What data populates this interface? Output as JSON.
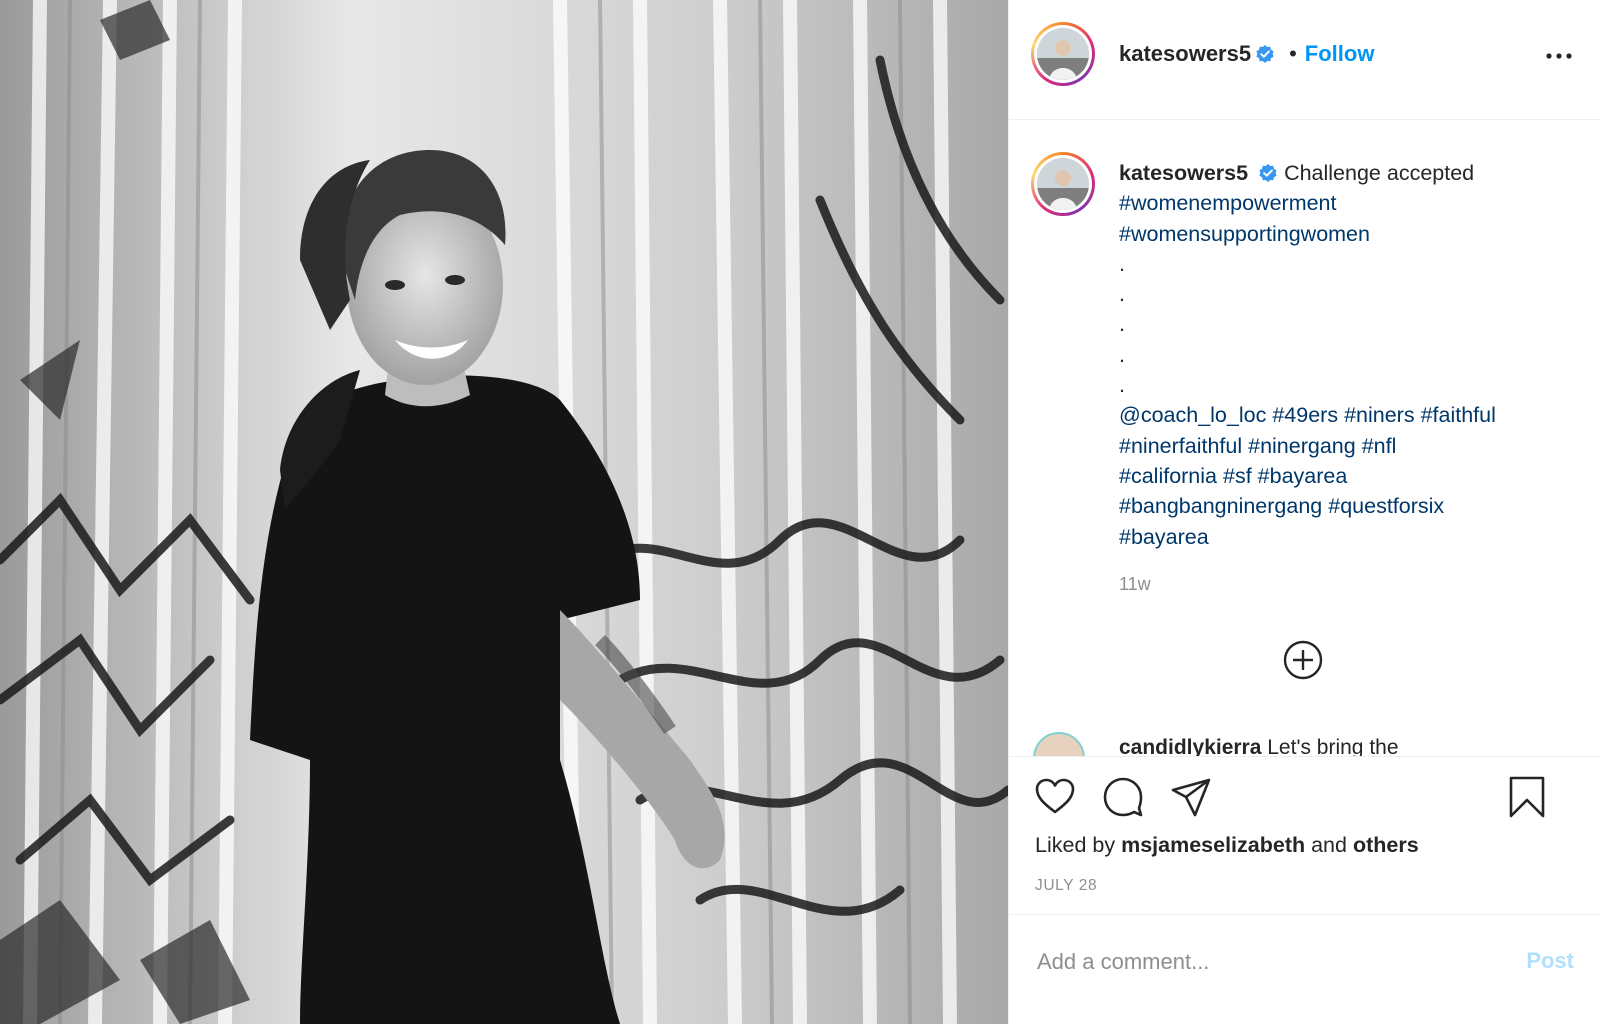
{
  "post": {
    "author": "katesowers5",
    "follow_label": "Follow",
    "separator": "•"
  },
  "caption": {
    "author": "katesowers5",
    "text": "Challenge accepted",
    "tag_line_1": "#womenempowerment",
    "tag_line_2": "#womensupportingwomen",
    "dots": [
      ".",
      ".",
      ".",
      ".",
      "."
    ],
    "tag_rows": [
      [
        "@coach_lo_loc",
        "#49ers",
        "#niners",
        "#faithful"
      ],
      [
        "#ninerfaithful",
        "#ninergang",
        "#nfl"
      ],
      [
        "#california",
        "#sf",
        "#bayarea"
      ],
      [
        "#bangbangninergang",
        "#questforsix"
      ],
      [
        "#bayarea"
      ]
    ],
    "time": "11w"
  },
  "next_comment": {
    "author": "candidlykierra",
    "text": "Let's bring the"
  },
  "likes": {
    "prefix": "Liked by",
    "user": "msjameselizabeth",
    "connector": "and",
    "others": "others"
  },
  "date": "JULY 28",
  "comment_box": {
    "placeholder": "Add a comment...",
    "post_label": "Post"
  },
  "icons": [
    "verified-badge-icon",
    "more-options-icon",
    "load-more-comments-icon",
    "heart-icon",
    "comment-icon",
    "share-icon",
    "bookmark-icon"
  ],
  "colors": {
    "follow": "#0095f6",
    "hashtag": "#00376b",
    "muted": "#8e8e8e",
    "post_disabled": "#b2dffc",
    "verified": "#3897f0"
  }
}
